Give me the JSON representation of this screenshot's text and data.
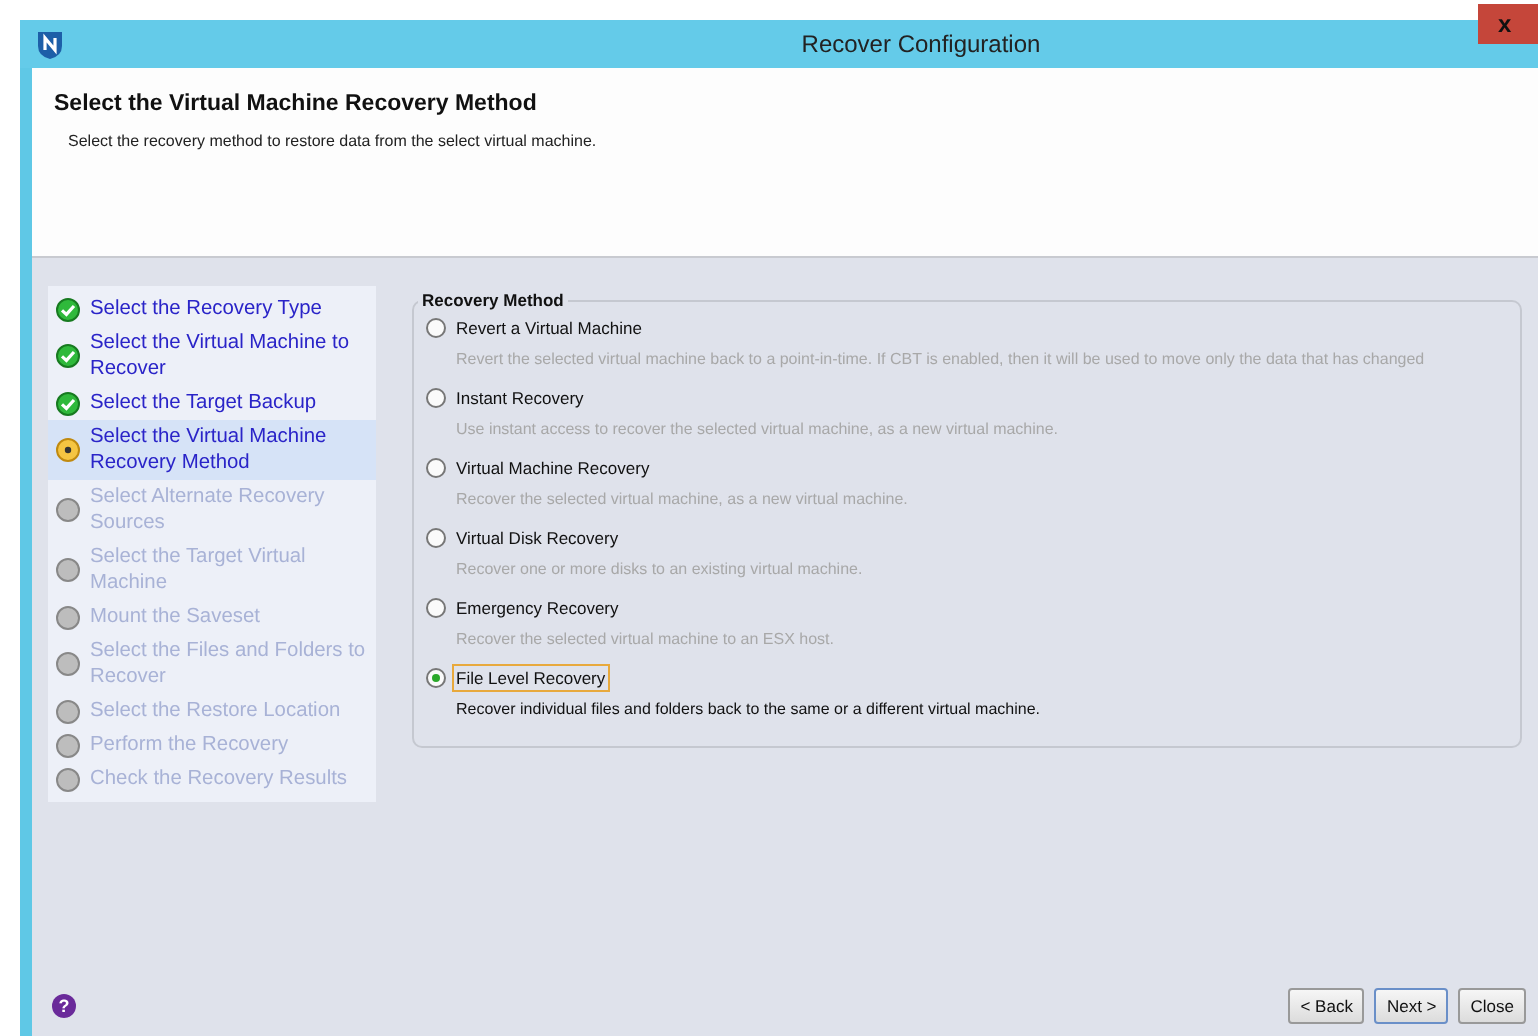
{
  "window": {
    "title": "Recover Configuration",
    "close": "x"
  },
  "header": {
    "title": "Select the Virtual Machine Recovery Method",
    "subtitle": "Select the recovery method to restore data from the select virtual machine."
  },
  "steps": [
    {
      "label": "Select the Recovery Type",
      "completed": true,
      "selected": false
    },
    {
      "label": "Select the Virtual Machine to Recover",
      "completed": true,
      "selected": false
    },
    {
      "label": "Select the Target Backup",
      "completed": true,
      "selected": false
    },
    {
      "label": "Select the Virtual Machine Recovery Method",
      "completed": false,
      "selected": true
    },
    {
      "label": "Select Alternate Recovery Sources",
      "completed": false,
      "selected": false
    },
    {
      "label": "Select the Target Virtual Machine",
      "completed": false,
      "selected": false
    },
    {
      "label": "Mount the Saveset",
      "completed": false,
      "selected": false
    },
    {
      "label": "Select the Files and Folders to Recover",
      "completed": false,
      "selected": false
    },
    {
      "label": "Select the Restore Location",
      "completed": false,
      "selected": false
    },
    {
      "label": "Perform the Recovery",
      "completed": false,
      "selected": false
    },
    {
      "label": "Check the Recovery Results",
      "completed": false,
      "selected": false
    }
  ],
  "recovery_method": {
    "legend": "Recovery Method",
    "options": [
      {
        "label": "Revert a Virtual Machine",
        "description": "Revert the selected virtual machine back to a point-in-time. If CBT is enabled, then it will be used to move only the data that has changed",
        "selected": false
      },
      {
        "label": "Instant Recovery",
        "description": "Use instant access to recover the selected virtual machine, as a new virtual machine.",
        "selected": false
      },
      {
        "label": "Virtual Machine Recovery",
        "description": "Recover the selected virtual machine, as a new virtual machine.",
        "selected": false
      },
      {
        "label": "Virtual Disk Recovery",
        "description": "Recover one or more disks to an existing virtual machine.",
        "selected": false
      },
      {
        "label": "Emergency Recovery",
        "description": "Recover the selected virtual machine to an ESX host.",
        "selected": false
      },
      {
        "label": "File Level Recovery",
        "description": "Recover individual files and folders back to the same or a different virtual machine.",
        "selected": true
      }
    ]
  },
  "footer": {
    "help": "?",
    "buttons": [
      {
        "label": "< Back",
        "kind": "normal"
      },
      {
        "label": "Next >",
        "kind": "default"
      },
      {
        "label": "Close",
        "kind": "normal"
      }
    ]
  }
}
